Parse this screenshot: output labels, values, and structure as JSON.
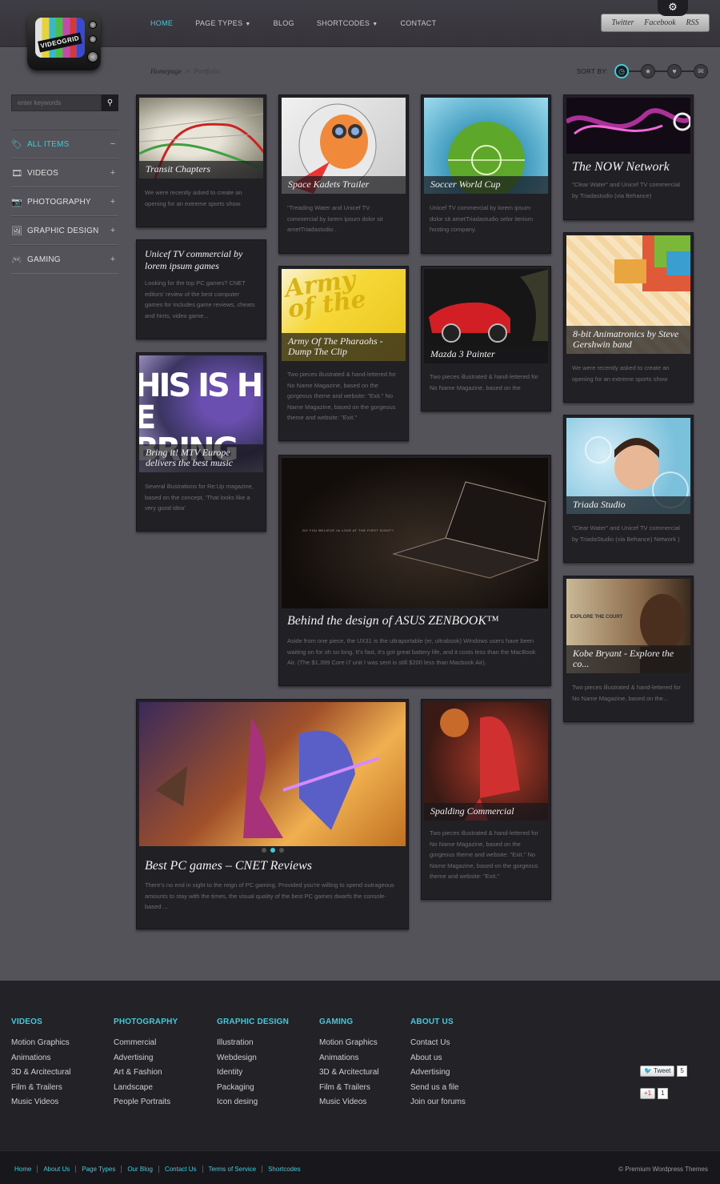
{
  "header": {
    "logo_text": "VIDEOGRID",
    "nav": [
      {
        "label": "HOME",
        "active": true,
        "dropdown": false
      },
      {
        "label": "PAGE TYPES",
        "active": false,
        "dropdown": true
      },
      {
        "label": "BLOG",
        "active": false,
        "dropdown": false
      },
      {
        "label": "SHORTCODES",
        "active": false,
        "dropdown": true
      },
      {
        "label": "CONTACT",
        "active": false,
        "dropdown": false
      }
    ],
    "social": [
      "Twitter",
      "Facebook",
      "RSS"
    ],
    "settings_icon": "gear-icon"
  },
  "breadcrumb": {
    "home": "Homepage",
    "sep": ">",
    "current": "Portfolio"
  },
  "sort": {
    "label": "SORT BY:",
    "options": [
      "clock-icon",
      "star-icon",
      "heart-icon",
      "comment-icon"
    ]
  },
  "sidebar": {
    "search_placeholder": "enter keywords",
    "categories": [
      {
        "label": "ALL ITEMS",
        "icon": "tag-icon",
        "toggle": "−",
        "active": true
      },
      {
        "label": "VIDEOS",
        "icon": "film-icon",
        "toggle": "+",
        "active": false
      },
      {
        "label": "PHOTOGRAPHY",
        "icon": "camera-icon",
        "toggle": "+",
        "active": false
      },
      {
        "label": "GRAPHIC DESIGN",
        "icon": "picture-icon",
        "toggle": "+",
        "active": false
      },
      {
        "label": "GAMING",
        "icon": "gamepad-icon",
        "toggle": "+",
        "active": false
      }
    ]
  },
  "cards": {
    "transit": {
      "title": "Transit Chapters",
      "desc": "We were recently asked to create an opening for an extreme sports show."
    },
    "unicef": {
      "title": "Unicef TV commercial by lorem ipsum games",
      "desc": "Looking for the top PC games? CNET editors' review of the best computer games for includes game reviews, cheats and hints, video game..."
    },
    "mtv": {
      "title": "Bring it! MTV Europe delivers the best music",
      "desc": "Several illustrations for Re:Up magazine, based on the concept, 'That looks like a very good idea'"
    },
    "kadets": {
      "title": "Space Kadets Trailer",
      "desc": "\"Treading Water and Unicef TV commercial by lorem ipsum dolor sit ametTriadastudio ."
    },
    "soccer": {
      "title": "Soccer World Cup",
      "desc": "Unicef TV commercial by lorem ipsum dolor sit ametTriadastudio selor iterium hosting company."
    },
    "now": {
      "title": "The NOW Network",
      "desc": "\"Clear Water\" and Unicef TV commercial by Triadastudio (via Behance)"
    },
    "army": {
      "title": "Army Of The Pharaohs - Dump The Clip",
      "desc": "Two pieces illustrated & hand-lettered for No Name Magazine, based on the gorgeous theme and website: \"Exit.\" No Name Magazine, based on the gorgeous theme and website: \"Exit.\""
    },
    "mazda": {
      "title": "Mazda 3 Painter",
      "desc": "Two pieces illustrated & hand-lettered for No Name Magazine, based on the"
    },
    "bit": {
      "title": "8-bit Animatronics by Steve Gershwin band",
      "desc": "We were recently asked to create an opening for an extreme sports show"
    },
    "asus": {
      "title": "Behind the design of ASUS ZENBOOK™",
      "desc": "Aside from one piece, the UX31 is the ultraportable (er, ultrabook) Windows users have been waiting on for oh so long. It's fast, it's got great battery life, and it costs less than the MacBook Air. (The $1,399 Core i7 unit I was sent is still $200 less than Macbook Air).",
      "tagline": "DO YOU BELIEVE IN LOVE AT THE FIRST SIGHT?"
    },
    "triada": {
      "title": "Triada Studio",
      "desc": "\"Clear Water\" and Unicef TV commercial by TriadaStudio (via Behance) Network )"
    },
    "kobe": {
      "title": "Kobe Bryant - Explore the co...",
      "desc": "Two pieces illustrated & hand-lettered for No Name Magazine, based on the...",
      "overlay": "EXPLORE THE COURT"
    },
    "pcgames": {
      "title": "Best PC games – CNET Reviews",
      "desc": "There's no end in sight to the reign of PC gaming. Provided you're willing to spend outrageous amounts to stay with the times, the visual quality of the best PC games dwarfs the console-based ..."
    },
    "spalding": {
      "title": "Spalding Commercial",
      "desc": "Two pieces illustrated & hand-lettered for No Name Magazine, based on the gorgeous theme and website: \"Exit.\" No Name Magazine, based on the gorgeous theme and website: \"Exit.\""
    }
  },
  "footer": {
    "columns": [
      {
        "head": "VIDEOS",
        "links": [
          "Motion Graphics",
          "Animations",
          "3D & Arcitectural",
          "Film & Trailers",
          "Music Videos"
        ]
      },
      {
        "head": "PHOTOGRAPHY",
        "links": [
          "Commercial",
          "Advertising",
          "Art & Fashion",
          "Landscape",
          "People Portraits"
        ]
      },
      {
        "head": "GRAPHIC DESIGN",
        "links": [
          "Illustration",
          "Webdesign",
          "Identity",
          "Packaging",
          "Icon desing"
        ]
      },
      {
        "head": "GAMING",
        "links": [
          "Motion Graphics",
          "Animations",
          "3D & Arcitectural",
          "Film & Trailers",
          "Music Videos"
        ]
      },
      {
        "head": "ABOUT US",
        "links": [
          "Contact Us",
          "About us",
          "Advertising",
          "Send us a file",
          "Join our forums"
        ]
      }
    ],
    "tweet": {
      "label": "Tweet",
      "count": "5"
    },
    "gplus": {
      "label": "+1",
      "count": "1"
    },
    "bottom_links": [
      "Home",
      "About Us",
      "Page Types",
      "Our Blog",
      "Contact Us",
      "Terms of Service",
      "Shortcodes"
    ],
    "copyright": "© Premium Wordpress Themes"
  },
  "colors": {
    "accent": "#43c9d9",
    "background": "#55535a",
    "card": "#212024",
    "footer": "#232227"
  }
}
